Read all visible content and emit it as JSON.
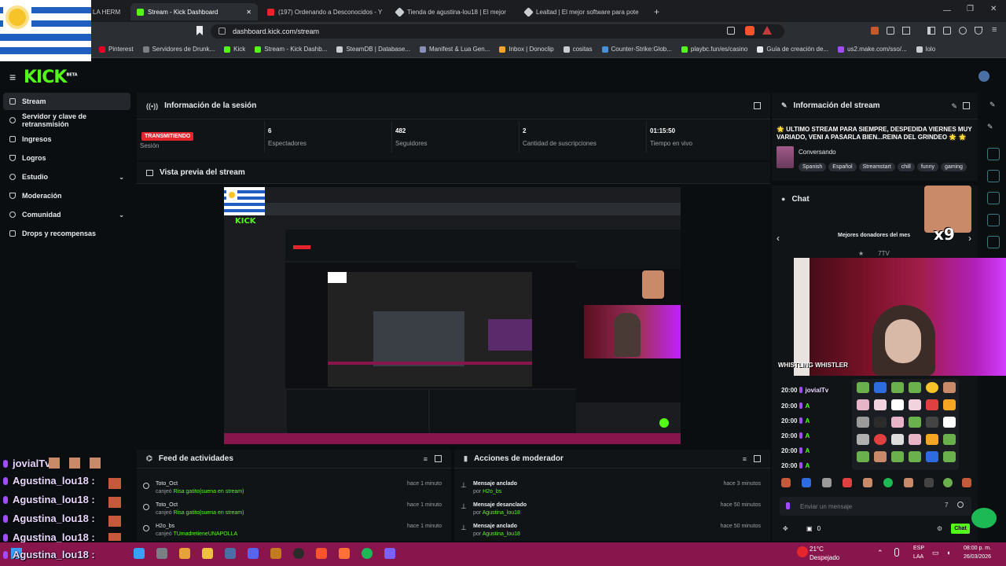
{
  "browser": {
    "tabs": [
      {
        "label": "LA HERM",
        "color": "#1f5fbf"
      },
      {
        "label": "Stream - Kick Dashboard",
        "color": "#53fc18",
        "active": true
      },
      {
        "label": "(197) Ordenando a Desconocidos - Y",
        "color": "#e4252c"
      },
      {
        "label": "Tienda de agustina-lou18 | El mejor",
        "color": "#c9cdd2"
      },
      {
        "label": "Lealtad | El mejor software para pote",
        "color": "#c9cdd2"
      }
    ],
    "new_tab": "+",
    "url": "dashboard.kick.com/stream",
    "bookmarks": [
      {
        "label": "Pinterest",
        "color": "#e60023"
      },
      {
        "label": "Servidores de Drunk...",
        "color": "#7a7f86"
      },
      {
        "label": "Kick",
        "color": "#53fc18"
      },
      {
        "label": "Stream - Kick Dashb...",
        "color": "#53fc18"
      },
      {
        "label": "SteamDB | Database...",
        "color": "#c9cdd2"
      },
      {
        "label": "Manifest & Lua Gen...",
        "color": "#8a8fb5"
      },
      {
        "label": "Inbox | Donoclip",
        "color": "#f6a623"
      },
      {
        "label": "cositas",
        "color": "#c9cdd2"
      },
      {
        "label": "Counter-Strike:Glob...",
        "color": "#4a90d9"
      },
      {
        "label": "playbc.fun/es/casino",
        "color": "#53fc18"
      },
      {
        "label": "Guía de creación de...",
        "color": "#e8eaed"
      },
      {
        "label": "us2.make.com/sso/...",
        "color": "#a24cff"
      },
      {
        "label": "lolo",
        "color": "#c9cdd2"
      }
    ]
  },
  "app": {
    "logo": "KICK",
    "logo_sup": "BETA"
  },
  "sidebar": {
    "items": [
      {
        "label": "Stream",
        "active": true
      },
      {
        "label": "Servidor y clave de retransmisión"
      },
      {
        "label": "Ingresos"
      },
      {
        "label": "Logros"
      },
      {
        "label": "Estudio",
        "expandable": true
      },
      {
        "label": "Moderación"
      },
      {
        "label": "Comunidad",
        "expandable": true
      },
      {
        "label": "Drops y recompensas"
      }
    ]
  },
  "session": {
    "title": "Información de la sesión",
    "status_badge": "TRANSMITIENDO",
    "status_label": "Sesión",
    "stats": [
      {
        "value": "6",
        "label": "Espectadores"
      },
      {
        "value": "482",
        "label": "Seguidores"
      },
      {
        "value": "2",
        "label": "Cantidad de suscripciones"
      },
      {
        "value": "01:15:50",
        "label": "Tiempo en vivo"
      }
    ]
  },
  "preview": {
    "title": "Vista previa del stream"
  },
  "stream_info": {
    "title": "Información del stream",
    "stream_title": "🌟 ULTIMO STREAM PARA SIEMPRE, DESPEDIDA VIERNES MUY VARIADO, VENI A PASARLA BIEN...REINA DEL GRINDEO 🌟 🌟",
    "category": "Conversando",
    "tags": [
      "Spanish",
      "Español",
      "Streamstart",
      "chill",
      "funny",
      "gaming"
    ]
  },
  "chat": {
    "title": "Chat",
    "donors_title": "Mejores donadores del mes",
    "multiplier": "x9",
    "input_placeholder": "Enviar un mensaje",
    "send_label": "Chat",
    "points": "0",
    "overlay_text": "WHISTLING WHISTLER",
    "lines": [
      {
        "time": "20:00",
        "user": "jovialTv"
      },
      {
        "time": "20:00",
        "user": "A"
      },
      {
        "time": "20:00",
        "user": "A"
      },
      {
        "time": "20:00",
        "user": "A"
      },
      {
        "time": "20:00",
        "user": "A"
      },
      {
        "time": "20:00",
        "user": "A"
      }
    ]
  },
  "activity_feed": {
    "title": "Feed de actividades",
    "rows": [
      {
        "user": "Toto_Oct",
        "action": "canjeó",
        "reward": "Risa gatito(suena en stream)",
        "time": "hace 1 minuto"
      },
      {
        "user": "Toto_Oct",
        "action": "canjeó",
        "reward": "Risa gatito(suena en stream)",
        "time": "hace 1 minuto"
      },
      {
        "user": "H2o_bs",
        "action": "canjeó",
        "reward": "TUmadretieneUNAPOLLA",
        "time": "hace 1 minuto"
      }
    ]
  },
  "mod_actions": {
    "title": "Acciones de moderador",
    "rows": [
      {
        "action": "Mensaje anclado",
        "by": "por",
        "user": "H2o_bs",
        "time": "hace 3 minutos"
      },
      {
        "action": "Mensaje desanclado",
        "by": "por",
        "user": "Agustina_lou18",
        "time": "hace 50 minutos"
      },
      {
        "action": "Mensaje anclado",
        "by": "por",
        "user": "Agustina_lou18",
        "time": "hace 50 minutos"
      }
    ]
  },
  "stream_overlay": {
    "names": [
      "jovialTv :",
      "Agustina_lou18 :",
      "Agustina_lou18 :",
      "Agustina_lou18 :",
      "Agustina_lou18 :",
      "Agustina_lou18 :"
    ]
  },
  "taskbar": {
    "weather_temp": "21°C",
    "weather_desc": "Despejado",
    "lang_top": "ESP",
    "lang_bottom": "LAA",
    "time": "08:00 p. m.",
    "date": "26/03/2026",
    "icon_colors": [
      "#3aa0ff",
      "#7a7f86",
      "#e8a23a",
      "#f0c040",
      "#4a6fa5",
      "#5865f2",
      "#c47a20",
      "#2b2b2b",
      "#fb542b",
      "#ff7139",
      "#1db954",
      "#7b61ff"
    ]
  }
}
